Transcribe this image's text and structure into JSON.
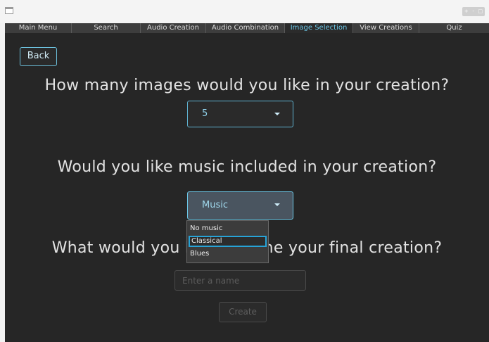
{
  "window": {
    "controls": [
      "+",
      "-",
      "□"
    ]
  },
  "tabs": [
    {
      "label": "Main Menu",
      "active": false
    },
    {
      "label": "Search",
      "active": false
    },
    {
      "label": "Audio Creation",
      "active": false
    },
    {
      "label": "Audio Combination",
      "active": false
    },
    {
      "label": "Image Selection",
      "active": true
    },
    {
      "label": "View Creations",
      "active": false
    },
    {
      "label": "Quiz",
      "active": false
    }
  ],
  "back_label": "Back",
  "questions": {
    "images": "How many images would you like in your creation?",
    "music": "Would you like music included in your creation?",
    "name": "What would you like to name your final creation?"
  },
  "image_count": {
    "selected": "5"
  },
  "music": {
    "selected": "Music",
    "options": [
      "No music",
      "Classical",
      "Blues"
    ],
    "highlighted": "Classical"
  },
  "name_input": {
    "placeholder": "Enter a name",
    "value": ""
  },
  "create_label": "Create",
  "colors": {
    "accent": "#6cc8e8",
    "background": "#262626",
    "tab_bar": "#3a3a3a"
  }
}
